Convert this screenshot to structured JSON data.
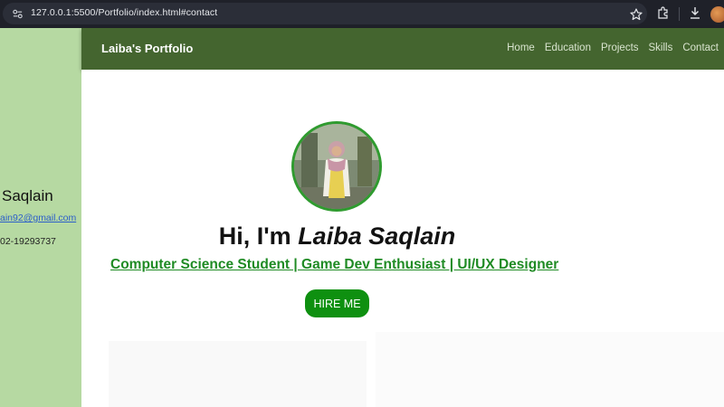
{
  "browser": {
    "url": "127.0.0.1:5500/Portfolio/index.html#contact",
    "icons": [
      "site-info-icon",
      "star-icon",
      "extensions-icon",
      "download-icon",
      "profile-icon"
    ]
  },
  "sidebar": {
    "name": "Saqlain",
    "email": "ain92@gmail.com",
    "phone": "02-19293737",
    "bg_color": "#b6d9a2"
  },
  "navbar": {
    "brand": "Laiba's Portfolio",
    "links": [
      "Home",
      "Education",
      "Projects",
      "Skills",
      "Contact"
    ],
    "bg_color": "#44652f"
  },
  "hero": {
    "greeting": "Hi, I'm ",
    "name": "Laiba Saqlain",
    "subtitle": "Computer Science Student | Game Dev Enthusiast | UI/UX Designer",
    "button": "HIRE ME",
    "accent_color": "#1f8b24",
    "button_color": "#0e9010"
  }
}
